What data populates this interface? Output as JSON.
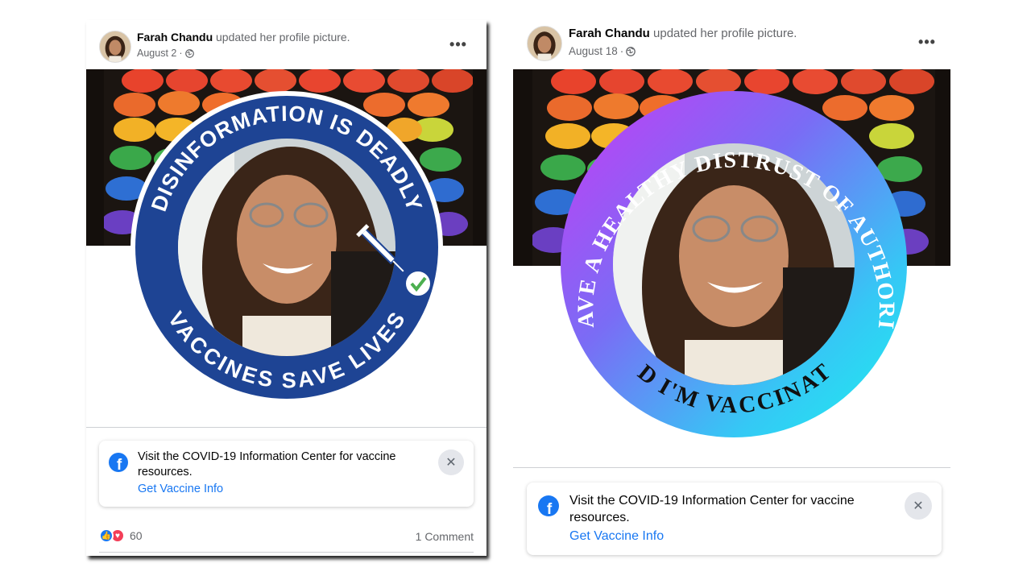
{
  "posts": [
    {
      "author": "Farah Chandu",
      "action": "updated her profile picture.",
      "date": "August 2",
      "date_sep": " ·",
      "frame_text_top": "DISINFORMATION IS DEADLY",
      "frame_text_bottom": "VACCINES SAVE LIVES",
      "frame_color": "#1e4494",
      "info_text": "Visit the COVID-19 Information Center for vaccine resources.",
      "info_link": "Get Vaccine Info",
      "reaction_count": "60",
      "comments": "1 Comment"
    },
    {
      "author": "Farah Chandu",
      "action": "updated her profile picture.",
      "date": "August 18",
      "date_sep": " ·",
      "frame_text_top": "I HAVE A HEALTHY DISTRUST OF AUTHORITY",
      "frame_text_bottom": "AND I'M VACCINATED",
      "frame_gradient": [
        "#c63cf5",
        "#7a6cf5",
        "#35c8f5",
        "#1cf0ee"
      ],
      "info_text": "Visit the COVID-19 Information Center for vaccine resources.",
      "info_link": "Get Vaccine Info"
    }
  ],
  "colors": {
    "link": "#1877f2",
    "meta": "#65676b",
    "like": "#1877f2",
    "love": "#f33e58"
  },
  "icons": {
    "more": "more-options-icon",
    "privacy": "globe-icon",
    "info": "facebook-logo-icon",
    "close": "close-icon",
    "like": "like-icon",
    "love": "love-icon",
    "syringe": "syringe-icon",
    "check": "checkmark-icon"
  }
}
